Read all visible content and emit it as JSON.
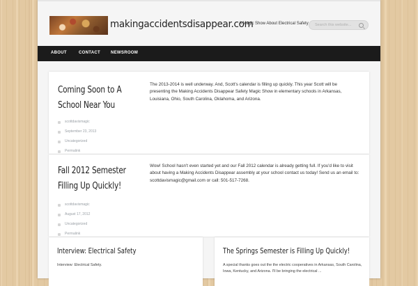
{
  "header": {
    "site_title": "makingaccidentsdisappear.com",
    "tagline": "A Magic Show About Electrical Safety",
    "search_placeholder": "Search this website..."
  },
  "nav": {
    "items": [
      "ABOUT",
      "CONTACT",
      "NEWSROOM"
    ]
  },
  "posts": [
    {
      "title_line1": "Coming Soon to A",
      "title_line2": "School Near You",
      "author": "scottdavismagic",
      "date": "September 23, 2013",
      "category": "Uncategorized",
      "permalink": "Permalink",
      "excerpt": "The 2013-2014 is well underway. And, Scott's calendar is filling up quickly. This year Scott will be presenting the Making Accidents Disappear Safety Magic Show in elementary schools in Arkansas, Louisiana, Ohio, South Carolina, Oklahoma, and Arizona."
    },
    {
      "title_line1": "Fall 2012 Semester",
      "title_line2": "Filling Up Quickly!",
      "author": "scottdavismagic",
      "date": "August 17, 2012",
      "category": "Uncategorized",
      "permalink": "Permalink",
      "excerpt": "Wow! School hasn't even started yet and our Fall 2012 calendar is already getting full. If you'd like to visit about having a Making Accidents Disappear assembly at your school contact us today! Send us an email to: scottdavismagic@gmail.com or call: 501-517-7268."
    }
  ],
  "bottom_posts": [
    {
      "title": "Interview: Electrical Safety",
      "excerpt": "Interview: Electrical Safety."
    },
    {
      "title": "The Springs Semester is Filling Up Quickly!",
      "excerpt": "A special thanks goes out the the electric cooperatives in Arkansas, South Carolina, Iowa, Kentucky, and Arizona. I'll be bringing the electrical ..."
    }
  ]
}
